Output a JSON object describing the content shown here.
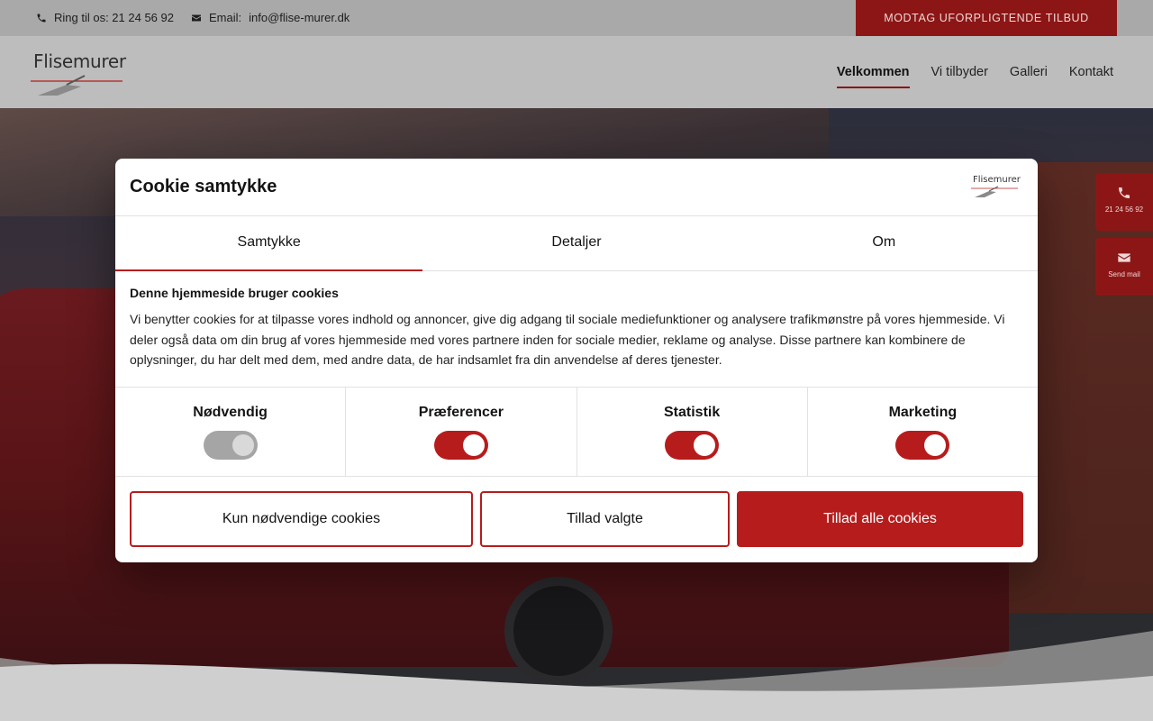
{
  "topbar": {
    "phone_text": "Ring til os: 21 24 56 92",
    "email_prefix": "Email: ",
    "email": "info@flise-murer.dk",
    "quote_button": "MODTAG UFORPLIGTENDE TILBUD"
  },
  "header": {
    "logo_text": "Flisemurer",
    "nav": [
      {
        "label": "Velkommen",
        "active": true
      },
      {
        "label": "Vi tilbyder"
      },
      {
        "label": "Galleri"
      },
      {
        "label": "Kontakt"
      }
    ]
  },
  "side": {
    "call_label": "21 24 56 92",
    "mail_label": "Send mail"
  },
  "cookie": {
    "title": "Cookie samtykke",
    "logo_text": "Flisemurer",
    "tabs": [
      "Samtykke",
      "Detaljer",
      "Om"
    ],
    "heading": "Denne hjemmeside bruger cookies",
    "text": "Vi benytter cookies for at tilpasse vores indhold og annoncer, give dig adgang til sociale mediefunktioner og analysere trafikmønstre på vores hjemmeside. Vi deler også data om din brug af vores hjemmeside med vores partnere inden for sociale medier, reklame og analyse. Disse partnere kan kombinere de oplysninger, du har delt med dem, med andre data, de har indsamlet fra din anvendelse af deres tjenester.",
    "toggles": [
      {
        "label": "Nødvendig",
        "on": true,
        "disabled": true
      },
      {
        "label": "Præferencer",
        "on": true
      },
      {
        "label": "Statistik",
        "on": true
      },
      {
        "label": "Marketing",
        "on": true
      }
    ],
    "buttons": {
      "necessary": "Kun nødvendige cookies",
      "selected": "Tillad valgte",
      "all": "Tillad alle cookies"
    }
  },
  "colors": {
    "accent": "#b71c1c",
    "dark_red": "#8c1616"
  }
}
